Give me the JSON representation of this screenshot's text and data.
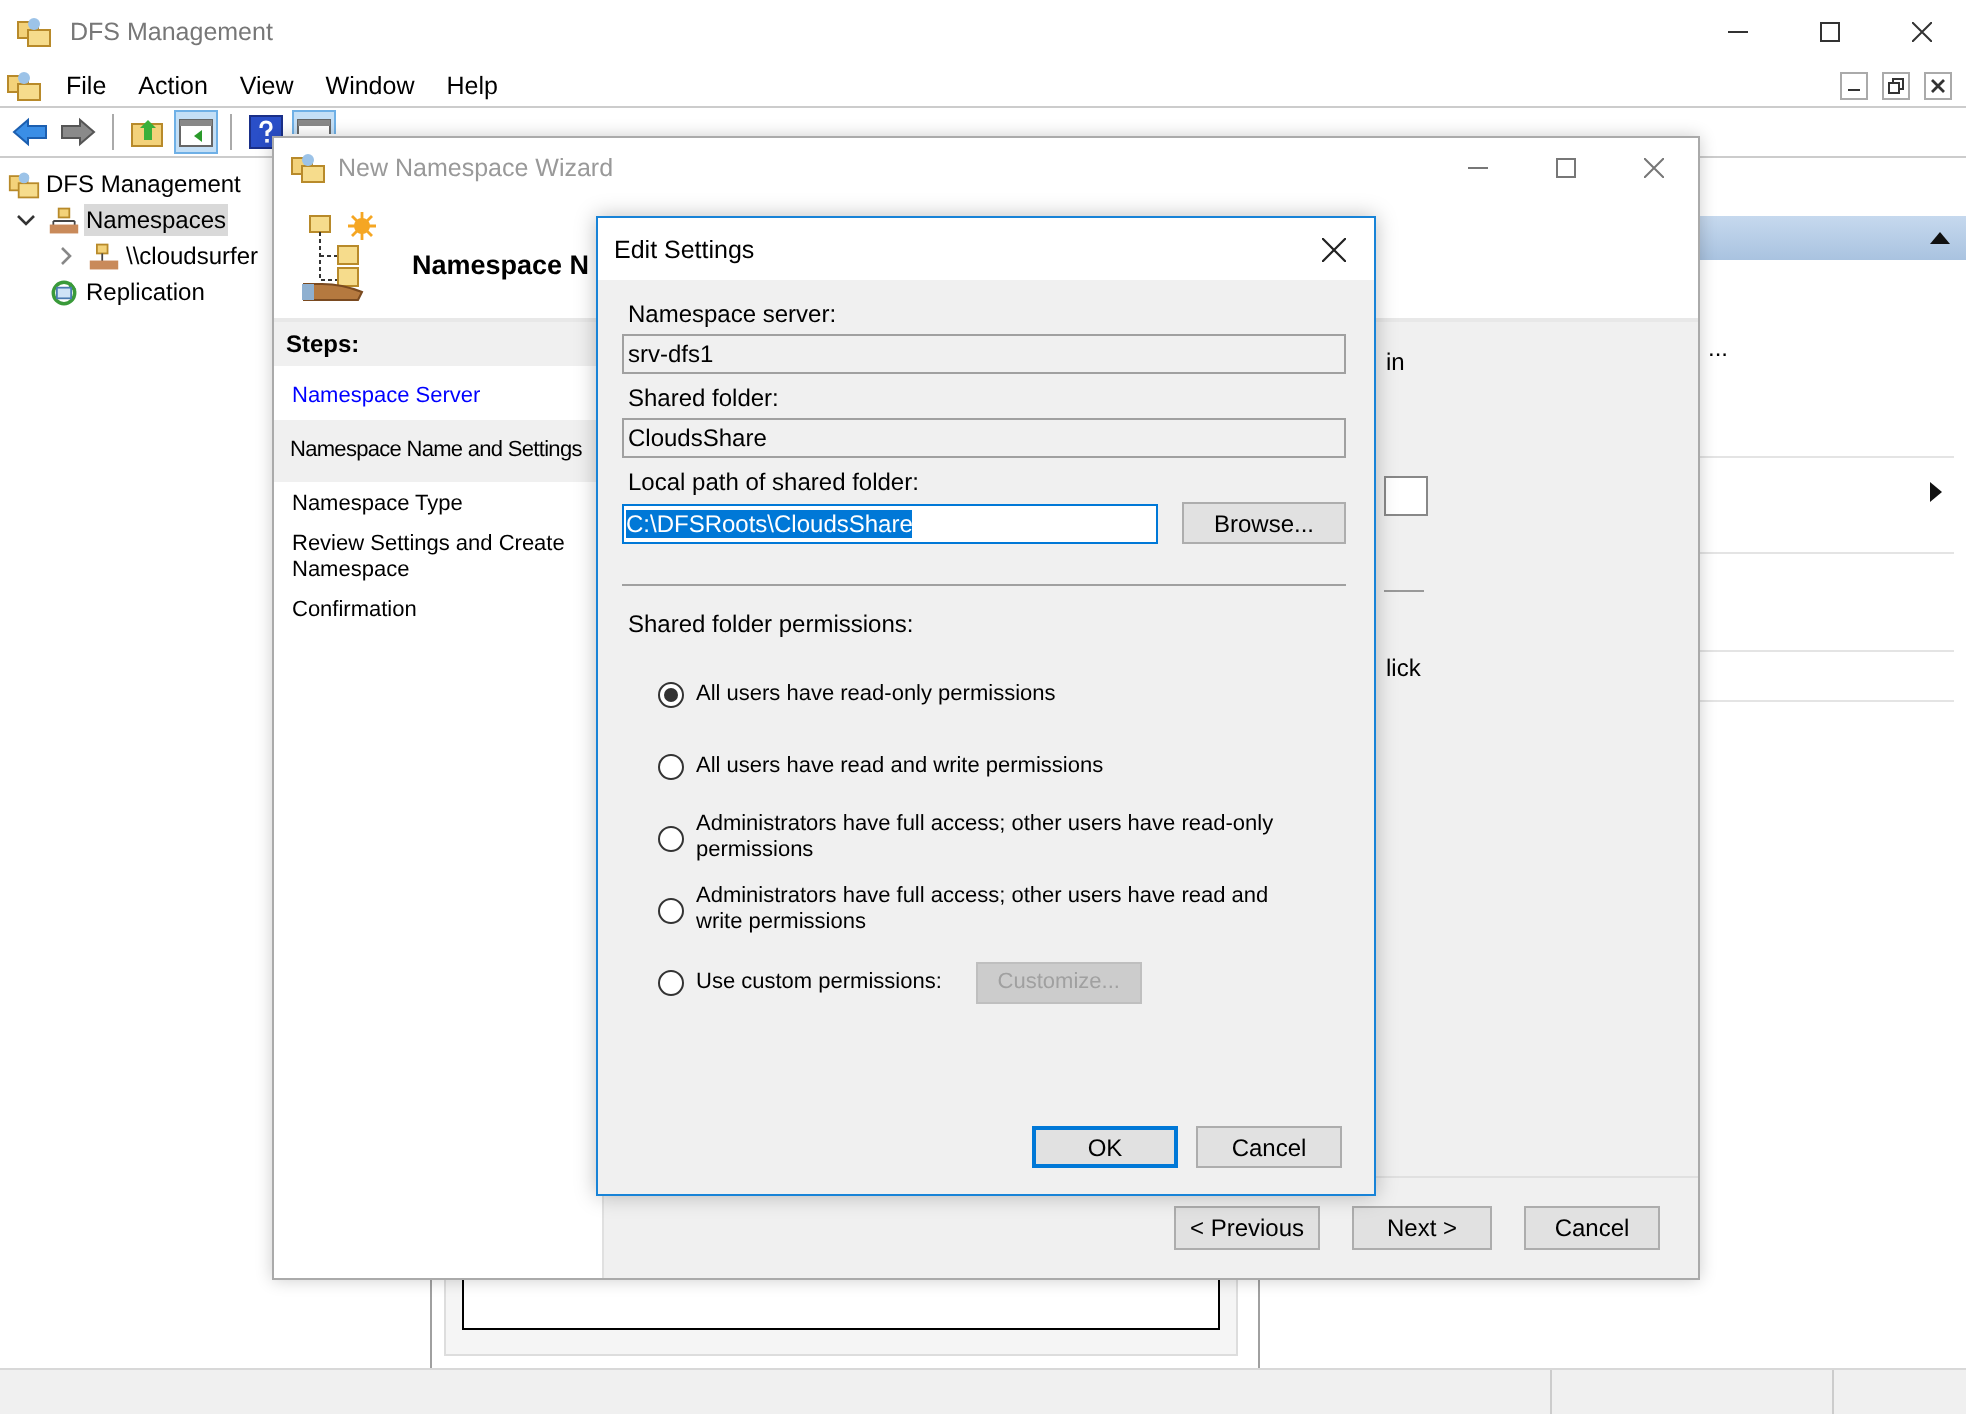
{
  "main_window": {
    "title": "DFS Management",
    "menu": [
      "File",
      "Action",
      "View",
      "Window",
      "Help"
    ],
    "toolbar": [
      {
        "kind": "back",
        "pressed": false
      },
      {
        "kind": "forward",
        "pressed": false
      },
      {
        "kind": "separator"
      },
      {
        "kind": "up",
        "pressed": false
      },
      {
        "kind": "tree-toggle",
        "pressed": true
      },
      {
        "kind": "separator"
      },
      {
        "kind": "help",
        "pressed": false
      },
      {
        "kind": "panel",
        "pressed": true
      }
    ],
    "tree": [
      {
        "label": "DFS Management",
        "kind": "root",
        "selected": false,
        "children": [
          {
            "label": "Namespaces",
            "kind": "namespaces",
            "selected": true,
            "expanded": true,
            "children": [
              {
                "label": "\\\\cloudsurfer",
                "kind": "namespace",
                "selected": false,
                "expanded": false
              }
            ]
          },
          {
            "label": "Replication",
            "kind": "replication",
            "selected": false
          }
        ]
      }
    ],
    "action_pane": {
      "fragment": "..."
    }
  },
  "wizard": {
    "title": "New Namespace Wizard",
    "heading": "Namespace N",
    "steps_title": "Steps:",
    "steps": [
      {
        "label": "Namespace Server",
        "selected": false,
        "completed": true
      },
      {
        "label": "Namespace Name and Settings",
        "selected": true,
        "completed": false
      },
      {
        "label": "Namespace Type",
        "selected": false,
        "completed": false
      },
      {
        "label": "Review Settings and Create Namespace",
        "selected": false,
        "completed": false
      },
      {
        "label": "Confirmation",
        "selected": false,
        "completed": false
      }
    ],
    "fragments": [
      "in",
      "lick"
    ],
    "buttons": [
      "< Previous",
      "Next >",
      "Cancel"
    ]
  },
  "dialog": {
    "title": "Edit Settings",
    "fields": [
      {
        "label": "Namespace server:",
        "value": "srv-dfs1",
        "kind": "readonly"
      },
      {
        "label": "Shared folder:",
        "value": "CloudsShare",
        "kind": "readonly"
      },
      {
        "label": "Local path of shared folder:",
        "value": "C:\\DFSRoots\\CloudsShare",
        "kind": "path",
        "text_selected": true,
        "button": "Browse..."
      }
    ],
    "permissions_label": "Shared folder permissions:",
    "options": [
      {
        "label": "All users have read-only permissions",
        "selected": true
      },
      {
        "label": "All users have read and write permissions",
        "selected": false
      },
      {
        "label": "Administrators have full access; other users have read-only permissions",
        "selected": false
      },
      {
        "label": "Administrators have full access; other users have read and write permissions",
        "selected": false
      },
      {
        "label": "Use custom permissions:",
        "selected": false,
        "button": {
          "label": "Customize...",
          "disabled": true
        }
      }
    ],
    "buttons": [
      {
        "label": "OK",
        "default": true
      },
      {
        "label": "Cancel",
        "default": false
      }
    ]
  }
}
